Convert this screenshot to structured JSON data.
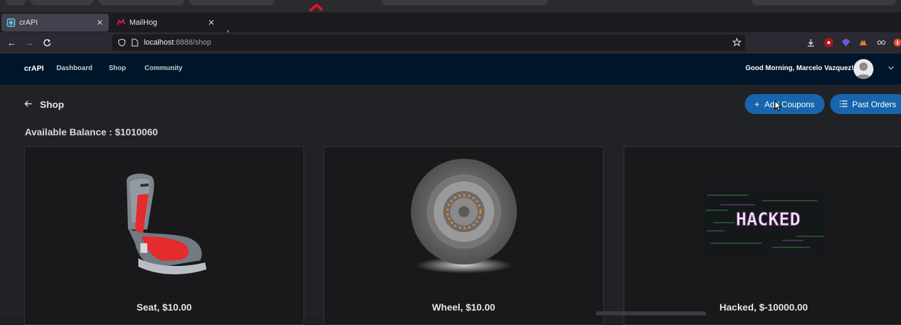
{
  "browser": {
    "tabs": [
      {
        "label": "crAPI",
        "active": true
      },
      {
        "label": "MailHog",
        "active": false
      }
    ],
    "new_tab": "+",
    "url": {
      "host": "localhost",
      "rest": ":8888/shop"
    }
  },
  "app": {
    "brand": "crAPI",
    "nav": [
      "Dashboard",
      "Shop",
      "Community"
    ],
    "greeting": "Good Morning, Marcelo Vazquez!",
    "accent": "#1765ad",
    "header_bg": "#001529"
  },
  "page": {
    "title": "Shop",
    "balance": "Available Balance : $1010060",
    "buttons": {
      "add_coupons": "Add Coupons",
      "past_orders": "Past Orders"
    }
  },
  "products": [
    {
      "label": "Seat, $10.00",
      "image": "car-seat"
    },
    {
      "label": "Wheel, $10.00",
      "image": "wheel"
    },
    {
      "label": "Hacked, $-10000.00",
      "image": "hacked-banner",
      "image_text": "HACKED"
    }
  ]
}
